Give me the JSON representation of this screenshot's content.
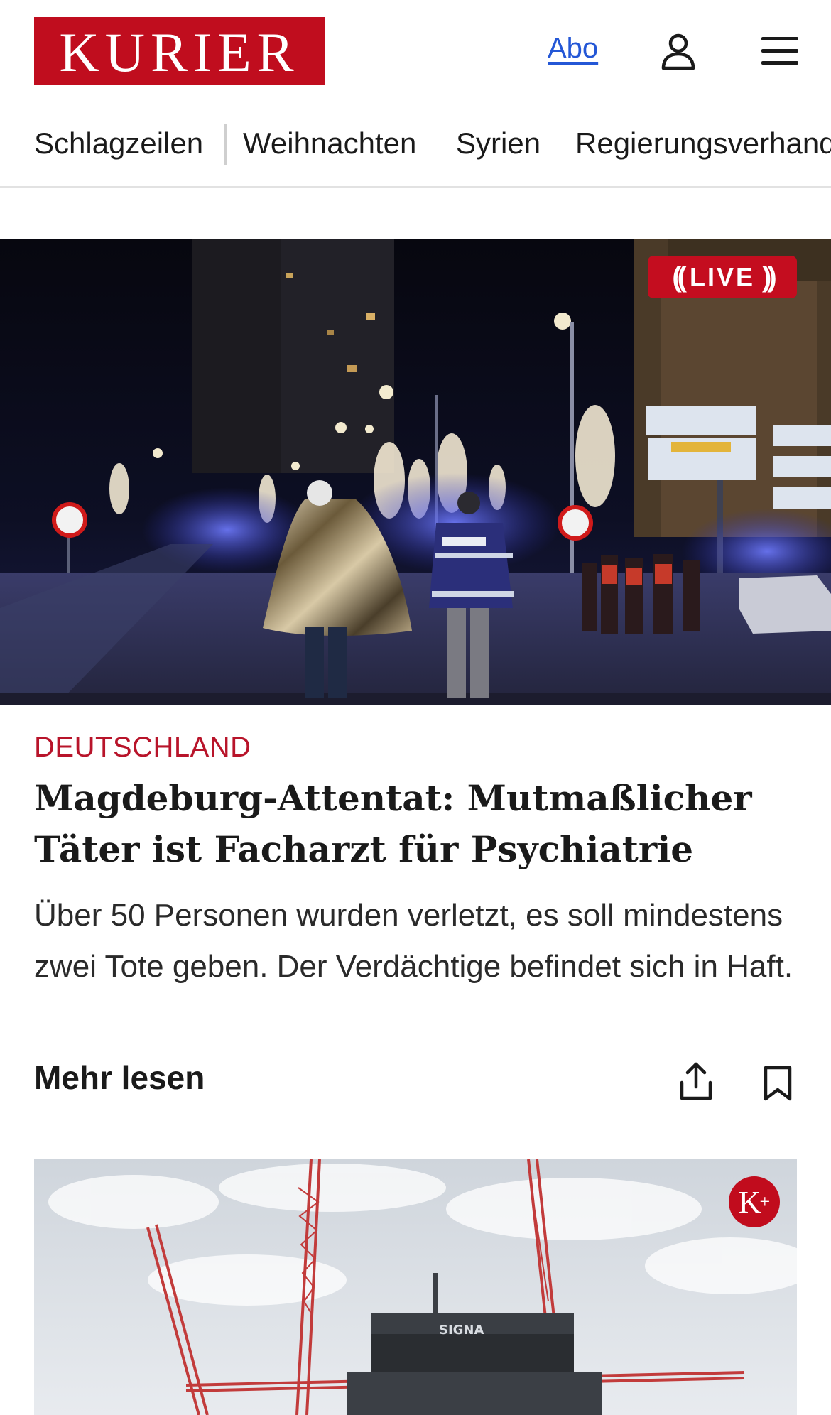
{
  "header": {
    "logo_text": "KURIER",
    "abo_label": "Abo",
    "user_icon": "user-icon",
    "menu_icon": "hamburger-menu-icon",
    "brand_color": "#c00d1e",
    "link_color": "#2457d6"
  },
  "nav": {
    "items": [
      "Schlagzeilen",
      "Weihnachten",
      "Syrien",
      "Regierungsverhand"
    ]
  },
  "hero": {
    "live_label": "LIVE",
    "live_color": "#c40d1f",
    "image_description_icon": "photo"
  },
  "article": {
    "kicker": "DEUTSCHLAND",
    "kicker_color": "#b8142a",
    "headline": "Magdeburg-Attentat: Mutmaßlicher Täter ist Facharzt für Psychiatrie",
    "teaser": "Über 50 Personen wurden verletzt, es soll mindestens zwei Tote geben. Der Verdächtige befindet sich in Haft.",
    "read_more": "Mehr lesen",
    "share_icon": "share-icon",
    "bookmark_icon": "bookmark-icon"
  },
  "second_card": {
    "badge_letter": "K",
    "badge_plus": "+",
    "image_sign_text": "SIGNA"
  }
}
